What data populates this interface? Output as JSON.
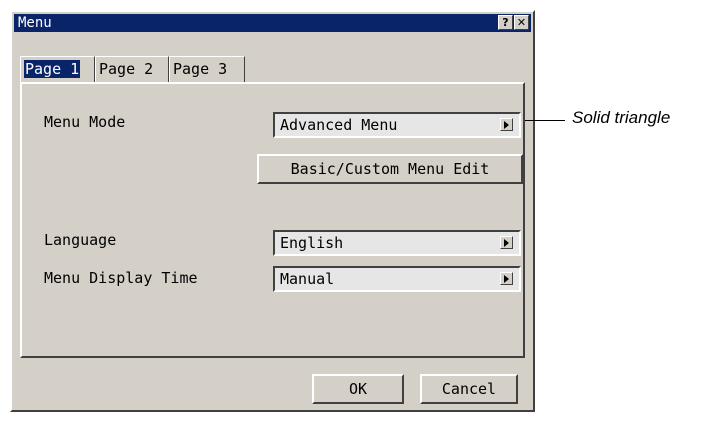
{
  "window": {
    "title": "Menu",
    "help_glyph": "?",
    "close_glyph": "✕"
  },
  "tabs": [
    {
      "label": "Page 1",
      "selected": true
    },
    {
      "label": "Page 2",
      "selected": false
    },
    {
      "label": "Page 3",
      "selected": false
    }
  ],
  "page1": {
    "menu_mode_label": "Menu Mode",
    "menu_mode_value": "Advanced Menu",
    "edit_button": "Basic/Custom Menu Edit",
    "language_label": "Language",
    "language_value": "English",
    "display_time_label": "Menu Display Time",
    "display_time_value": "Manual"
  },
  "footer": {
    "ok": "OK",
    "cancel": "Cancel"
  },
  "annotation": {
    "text": "Solid triangle"
  },
  "icons": [
    "help-icon",
    "close-icon",
    "dropdown-arrow-icon"
  ],
  "colors": {
    "face": "#d4d0c8",
    "titlebar": "#0a246a",
    "field": "#e6e6e6"
  }
}
